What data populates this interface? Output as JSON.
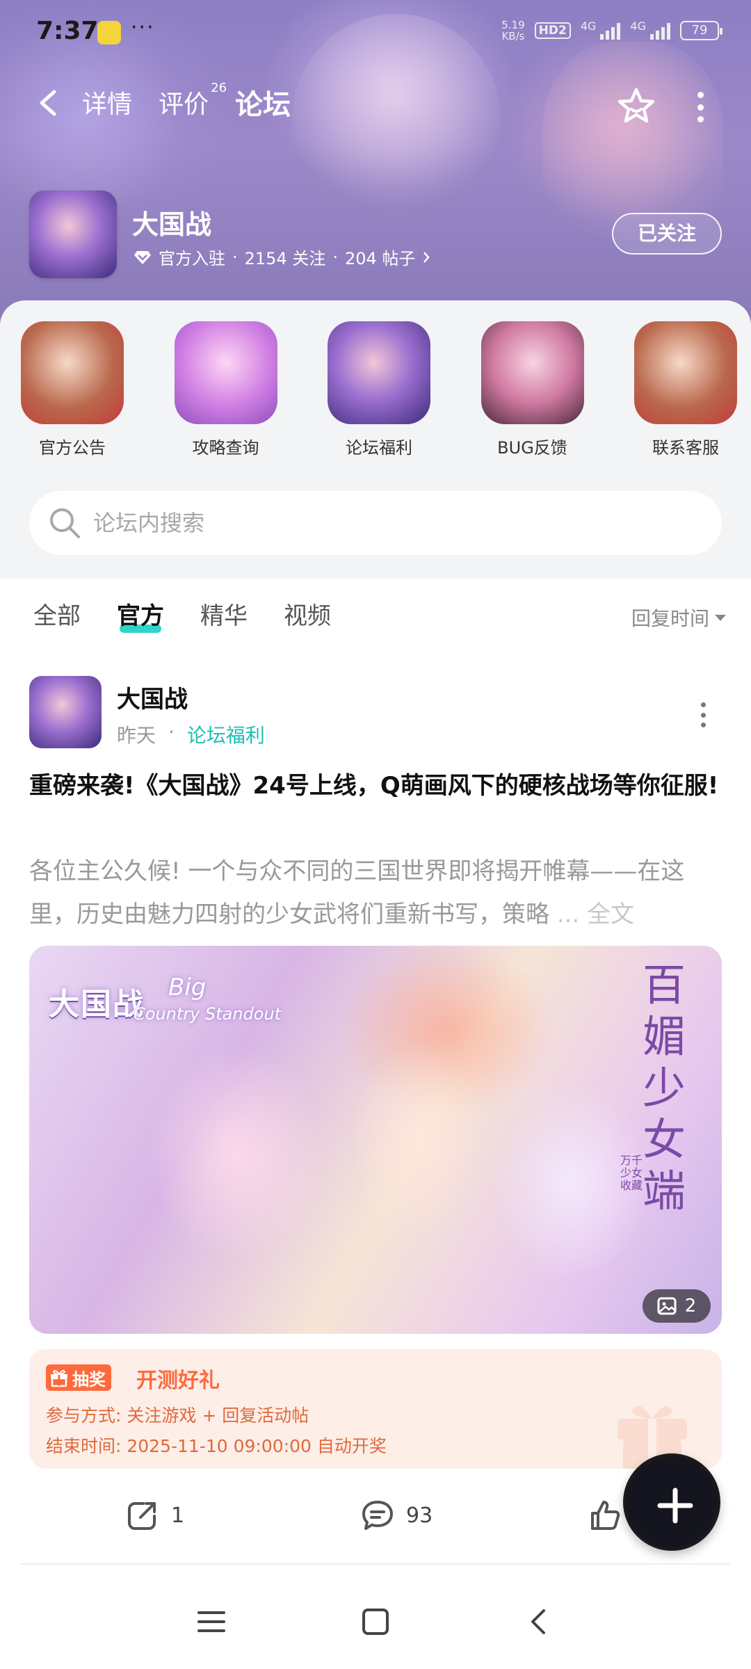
{
  "status_bar": {
    "time": "7:37",
    "dots": "···",
    "speed_value": "5.19",
    "speed_unit": "KB/s",
    "hd": "HD2",
    "net1": "4G",
    "net2": "4G",
    "battery": "79"
  },
  "nav": {
    "tabs": [
      {
        "label": "详情"
      },
      {
        "label": "评价",
        "badge": "26"
      },
      {
        "label": "论坛"
      }
    ],
    "active_tab": "论坛"
  },
  "game": {
    "name": "大国战",
    "verified": "官方入驻",
    "followers": "2154 关注",
    "posts": "204 帖子",
    "separator": "·",
    "follow_button": "已关注"
  },
  "shortcuts": [
    {
      "label": "官方公告"
    },
    {
      "label": "攻略查询"
    },
    {
      "label": "论坛福利"
    },
    {
      "label": "BUG反馈"
    },
    {
      "label": "联系客服"
    }
  ],
  "search": {
    "placeholder": "论坛内搜索"
  },
  "filters": {
    "tabs": [
      "全部",
      "官方",
      "精华",
      "视频"
    ],
    "active": "官方",
    "sort_label": "回复时间"
  },
  "post": {
    "author": "大国战",
    "time": "昨天",
    "separator": "·",
    "board": "论坛福利",
    "title": "重磅来袭!《大国战》24号上线，Q萌画风下的硬核战场等你征服!",
    "excerpt": "各位主公久候! 一个与众不同的三国世界即将揭开帷幕——在这里，历史由魅力四射的少女武将们重新书写，策略",
    "excerpt_more": "... 全文",
    "image": {
      "logo": "大国战",
      "logo_en": "Big",
      "logo_en2": "Country Standout",
      "vertical_text": "百媚少女端",
      "vertical_small": "万千少女收藏",
      "count": "2"
    },
    "lottery": {
      "badge": "抽奖",
      "title": "开测好礼",
      "line1": "参与方式: 关注游戏 + 回复活动帖",
      "line2": "结束时间: 2025-11-10 09:00:00 自动开奖"
    },
    "actions": {
      "shares": "1",
      "comments": "93"
    }
  },
  "colors": {
    "accent": "#24d3c5",
    "lottery_orange": "#ff6a3d",
    "board_green": "#19c1b4"
  }
}
